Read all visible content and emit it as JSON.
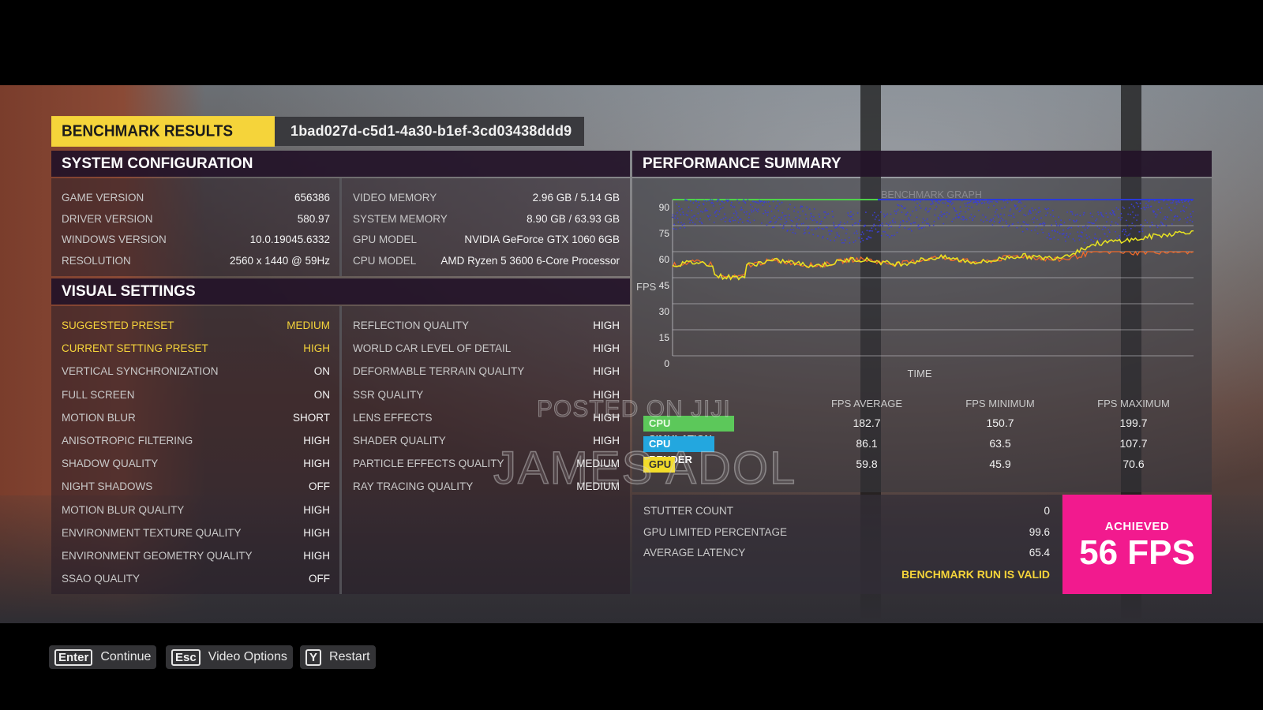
{
  "header": {
    "title": "BENCHMARK RESULTS",
    "run_id": "1bad027d-c5d1-4a30-b1ef-3cd03438ddd9"
  },
  "system_config": {
    "title": "SYSTEM CONFIGURATION",
    "left": [
      {
        "label": "GAME VERSION",
        "value": "656386"
      },
      {
        "label": "DRIVER VERSION",
        "value": "580.97"
      },
      {
        "label": "WINDOWS VERSION",
        "value": "10.0.19045.6332"
      },
      {
        "label": "RESOLUTION",
        "value": "2560 x 1440 @ 59Hz"
      }
    ],
    "right": [
      {
        "label": "VIDEO MEMORY",
        "value": "2.96 GB / 5.14 GB"
      },
      {
        "label": "SYSTEM MEMORY",
        "value": "8.90 GB / 63.93 GB"
      },
      {
        "label": "GPU MODEL",
        "value": "NVIDIA GeForce GTX 1060 6GB"
      },
      {
        "label": "CPU MODEL",
        "value": "AMD Ryzen 5 3600 6-Core Processor"
      }
    ]
  },
  "visual_settings": {
    "title": "VISUAL SETTINGS",
    "left": [
      {
        "label": "SUGGESTED PRESET",
        "value": "MEDIUM"
      },
      {
        "label": "CURRENT SETTING PRESET",
        "value": "HIGH"
      },
      {
        "label": "VERTICAL SYNCHRONIZATION",
        "value": "ON"
      },
      {
        "label": "FULL SCREEN",
        "value": "ON"
      },
      {
        "label": "MOTION BLUR",
        "value": "SHORT"
      },
      {
        "label": "ANISOTROPIC FILTERING",
        "value": "HIGH"
      },
      {
        "label": "SHADOW QUALITY",
        "value": "HIGH"
      },
      {
        "label": "NIGHT SHADOWS",
        "value": "OFF"
      },
      {
        "label": "MOTION BLUR QUALITY",
        "value": "HIGH"
      },
      {
        "label": "ENVIRONMENT TEXTURE QUALITY",
        "value": "HIGH"
      },
      {
        "label": "ENVIRONMENT GEOMETRY QUALITY",
        "value": "HIGH"
      },
      {
        "label": "SSAO QUALITY",
        "value": "OFF"
      }
    ],
    "right": [
      {
        "label": "REFLECTION QUALITY",
        "value": "HIGH"
      },
      {
        "label": "WORLD CAR LEVEL OF DETAIL",
        "value": "HIGH"
      },
      {
        "label": "DEFORMABLE TERRAIN QUALITY",
        "value": "HIGH"
      },
      {
        "label": "SSR QUALITY",
        "value": "HIGH"
      },
      {
        "label": "LENS EFFECTS",
        "value": "HIGH"
      },
      {
        "label": "SHADER QUALITY",
        "value": "HIGH"
      },
      {
        "label": "PARTICLE EFFECTS QUALITY",
        "value": "MEDIUM"
      },
      {
        "label": "RAY TRACING QUALITY",
        "value": "MEDIUM"
      }
    ]
  },
  "performance": {
    "title": "PERFORMANCE SUMMARY",
    "graph_title": "BENCHMARK GRAPH",
    "y_axis_label": "FPS",
    "x_axis_label": "TIME",
    "y_ticks": [
      "90",
      "75",
      "60",
      "45",
      "30",
      "15",
      "0"
    ],
    "columns": [
      "FPS AVERAGE",
      "FPS MINIMUM",
      "FPS MAXIMUM"
    ],
    "rows": [
      {
        "name": "CPU SIMULATION",
        "color": "#5cc85a",
        "text_color": "#eafbe6",
        "avg": "182.7",
        "min": "150.7",
        "max": "199.7"
      },
      {
        "name": "CPU RENDER",
        "color": "#23a7df",
        "text_color": "#ffffff",
        "avg": "86.1",
        "min": "63.5",
        "max": "107.7"
      },
      {
        "name": "GPU",
        "color": "#f2dc2a",
        "text_color": "#333333",
        "avg": "59.8",
        "min": "45.9",
        "max": "70.6"
      }
    ],
    "summary": [
      {
        "label": "STUTTER COUNT",
        "value": "0"
      },
      {
        "label": "GPU LIMITED PERCENTAGE",
        "value": "99.6"
      },
      {
        "label": "AVERAGE LATENCY",
        "value": "65.4"
      }
    ],
    "valid_text": "BENCHMARK RUN IS VALID",
    "achieved_label": "ACHIEVED",
    "achieved_value": "56 FPS"
  },
  "watermark": {
    "line1": "POSTED ON JIJI",
    "line2": "JAMES ADOL"
  },
  "controls": [
    {
      "key": "Enter",
      "label": "Continue"
    },
    {
      "key": "Esc",
      "label": "Video Options"
    },
    {
      "key": "Y",
      "label": "Restart"
    }
  ],
  "colors": {
    "accent_yellow": "#f5d43a",
    "achieved_pink": "#f21a8e",
    "section_bar": "#221228",
    "line_cap_green": "#4fd24a",
    "line_cap_blue": "#2a3ad8",
    "line_orange": "#f06a2a",
    "line_yellow": "#e9e421"
  }
}
